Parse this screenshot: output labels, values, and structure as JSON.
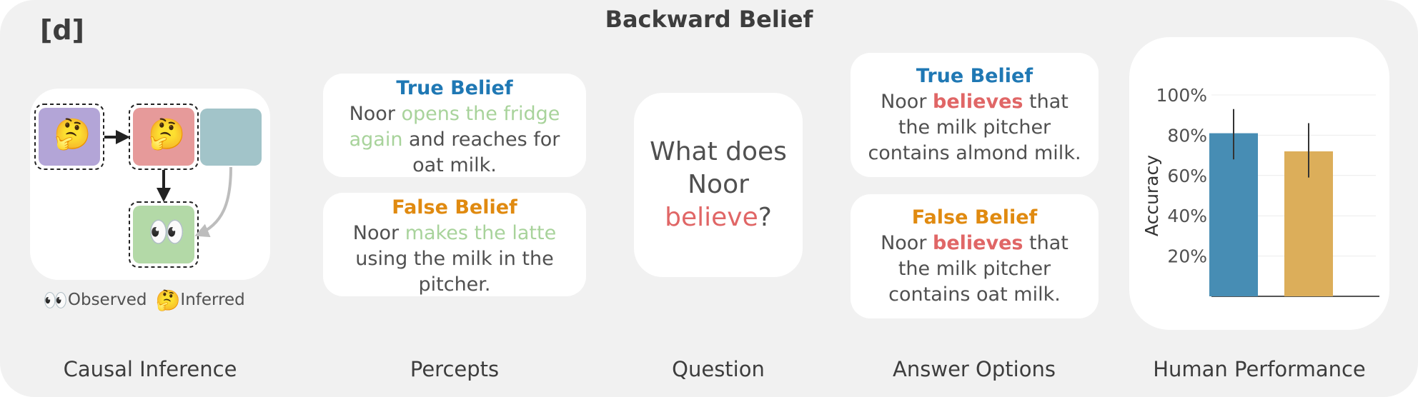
{
  "panel_tag": "[d]",
  "title": "Backward Belief",
  "causal": {
    "legend_observed": "Observed",
    "legend_inferred": "Inferred",
    "observed_icon": "eyes-emoji",
    "inferred_icon": "thinking-face-emoji",
    "node_colors": {
      "purple": "#b3a5d7",
      "red": "#e69a9a",
      "teal": "#a2c4c9",
      "green": "#b3d9a7"
    },
    "observed_glyph": "👀",
    "inferred_glyph": "🤔"
  },
  "percepts": {
    "true": {
      "header": "True Belief",
      "t1": "Noor ",
      "hl": "opens the fridge again",
      "t2": " and reaches for oat milk."
    },
    "false": {
      "header": "False Belief",
      "t1": "Noor ",
      "hl": "makes the latte",
      "t2": " using the milk in the pitcher."
    }
  },
  "question": {
    "l1": "What does",
    "l2": "Noor",
    "hl": "believe",
    "end": "?"
  },
  "answers": {
    "true": {
      "header": "True Belief",
      "t1": "Noor ",
      "hl": "believes",
      "t2": " that the milk pitcher contains almond milk."
    },
    "false": {
      "header": "False Belief",
      "t1": "Noor ",
      "hl": "believes",
      "t2": " that the milk pitcher contains oat milk."
    }
  },
  "columns": [
    "Causal Inference",
    "Percepts",
    "Question",
    "Answer Options",
    "Human Performance"
  ],
  "chart_data": {
    "type": "bar",
    "ylabel": "Accuracy",
    "yticks": [
      "20%",
      "40%",
      "60%",
      "80%",
      "100%"
    ],
    "ylim": [
      0,
      100
    ],
    "grid": true,
    "categories": [
      "",
      ""
    ],
    "values": [
      81,
      72
    ],
    "error_low": [
      68,
      59
    ],
    "error_high": [
      93,
      86
    ],
    "colors": [
      "#478db4",
      "#dcae5a"
    ]
  }
}
